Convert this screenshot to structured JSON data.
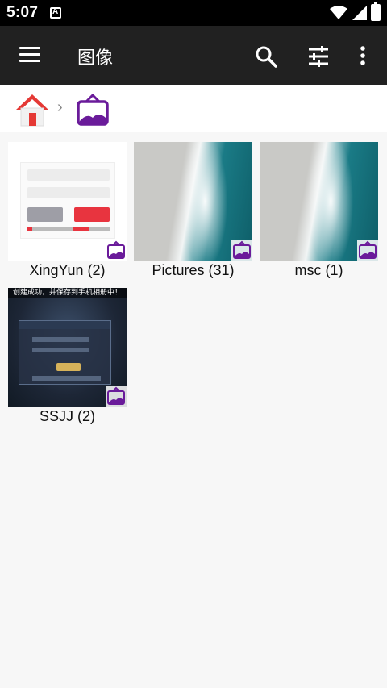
{
  "status_bar": {
    "time": "5:07"
  },
  "app_bar": {
    "title": "图像"
  },
  "breadcrumb": {
    "separator": "›"
  },
  "colors": {
    "toolbar": "#212121",
    "accent": "#6a1b9a",
    "home_roof": "#e53935"
  },
  "folders": [
    {
      "name": "XingYun",
      "count_label": "XingYun (2)"
    },
    {
      "name": "Pictures",
      "count_label": "Pictures (31)"
    },
    {
      "name": "msc",
      "count_label": "msc (1)"
    },
    {
      "name": "SSJJ",
      "count_label": "SSJJ (2)"
    }
  ],
  "ssjj_thumb": {
    "banner": "创建成功，并保存到手机相册中！"
  }
}
